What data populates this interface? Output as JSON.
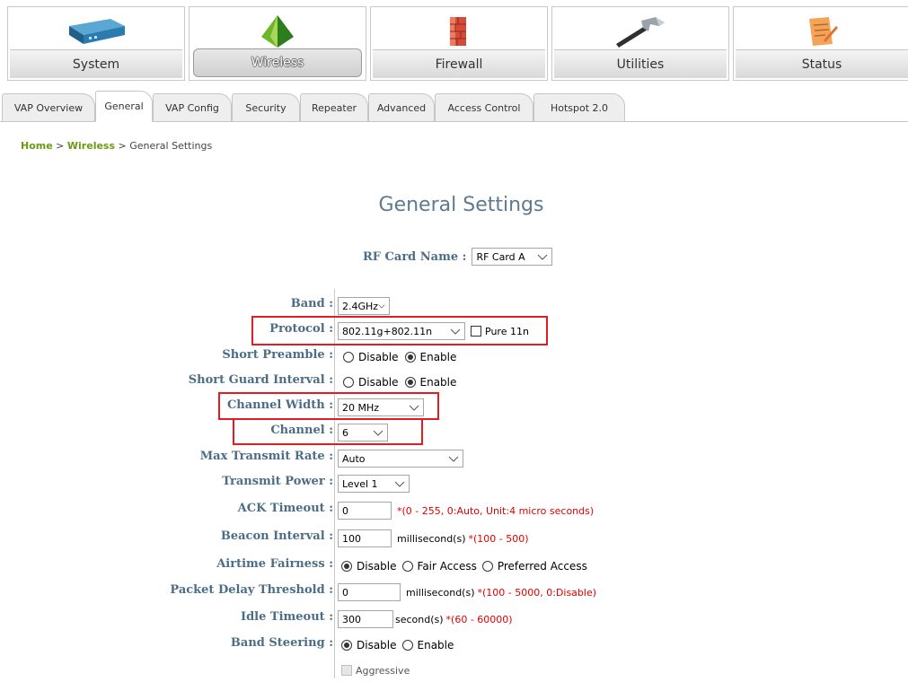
{
  "modules": [
    {
      "label": "System",
      "icon": "device-icon"
    },
    {
      "label": "Wireless",
      "icon": "wireless-pyramid-icon",
      "active": true
    },
    {
      "label": "Firewall",
      "icon": "firewall-icon"
    },
    {
      "label": "Utilities",
      "icon": "hammer-icon"
    },
    {
      "label": "Status",
      "icon": "notepad-icon"
    }
  ],
  "tabs": [
    "VAP Overview",
    "General",
    "VAP Config",
    "Security",
    "Repeater",
    "Advanced",
    "Access Control",
    "Hotspot 2.0"
  ],
  "active_tab": "General",
  "breadcrumb": {
    "home": "Home",
    "sep1": " > ",
    "wireless": "Wireless",
    "sep2": " > ",
    "current": "General Settings"
  },
  "title": "General Settings",
  "rf_card": {
    "label": "RF Card Name :",
    "value": "RF Card A"
  },
  "form": {
    "band": {
      "label": "Band :",
      "value": "2.4GHz"
    },
    "protocol": {
      "label": "Protocol :",
      "value": "802.11g+802.11n",
      "pure11n_label": "Pure 11n",
      "pure11n_checked": false
    },
    "short_preamble": {
      "label": "Short Preamble :",
      "opt1": "Disable",
      "opt2": "Enable",
      "selected": "Enable"
    },
    "short_guard": {
      "label": "Short Guard Interval :",
      "opt1": "Disable",
      "opt2": "Enable",
      "selected": "Enable"
    },
    "channel_width": {
      "label": "Channel Width :",
      "value": "20 MHz"
    },
    "channel": {
      "label": "Channel :",
      "value": "6"
    },
    "max_rate": {
      "label": "Max Transmit Rate :",
      "value": "Auto"
    },
    "tx_power": {
      "label": "Transmit Power :",
      "value": "Level 1"
    },
    "ack_timeout": {
      "label": "ACK Timeout :",
      "value": "0",
      "hint": "*(0 - 255, 0:Auto, Unit:4 micro seconds)"
    },
    "beacon": {
      "label": "Beacon Interval :",
      "value": "100",
      "unit": "millisecond(s)",
      "hint": "*(100 - 500)"
    },
    "airtime": {
      "label": "Airtime Fairness :",
      "opt1": "Disable",
      "opt2": "Fair Access",
      "opt3": "Preferred Access",
      "selected": "Disable"
    },
    "packet_delay": {
      "label": "Packet Delay Threshold :",
      "value": "0",
      "unit": "millisecond(s)",
      "hint": "*(100 - 5000, 0:Disable)"
    },
    "idle": {
      "label": "Idle Timeout :",
      "value": "300",
      "unit": "second(s)",
      "hint": "*(60 - 60000)"
    },
    "band_steering": {
      "label": "Band Steering :",
      "opt1": "Disable",
      "opt2": "Enable",
      "selected": "Disable",
      "aggressive_label": "Aggressive"
    }
  },
  "highlight_color": "#e31b23"
}
